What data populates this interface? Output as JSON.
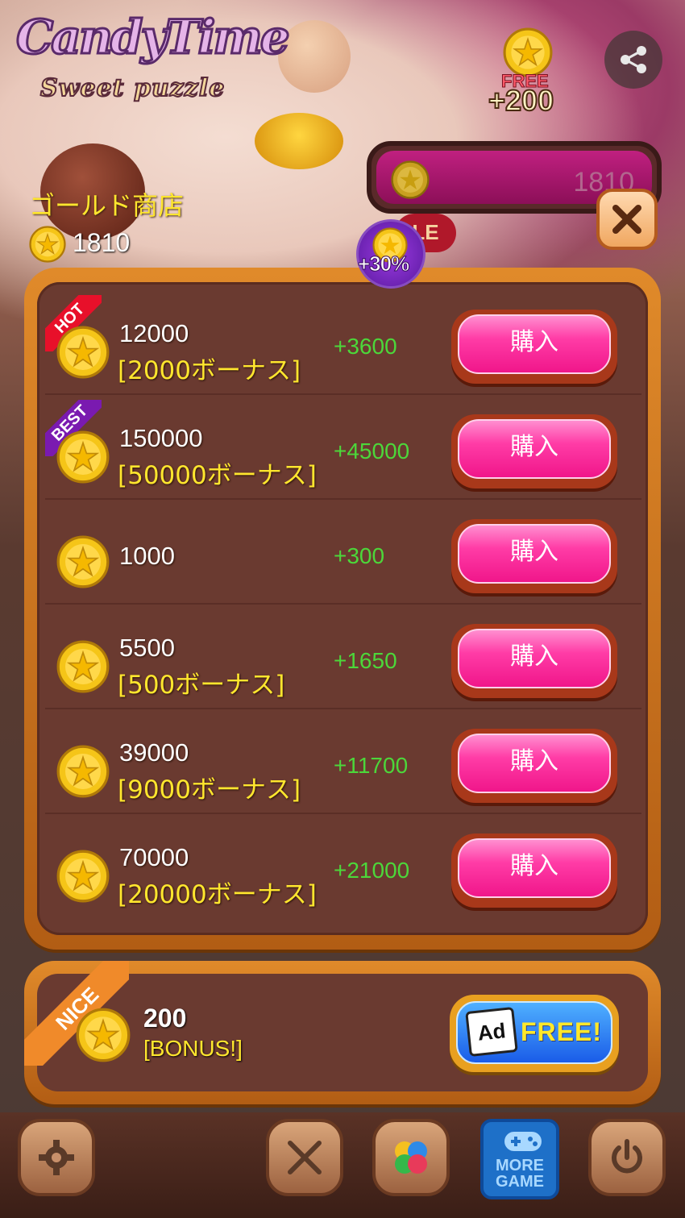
{
  "logo": {
    "line1": "CandyTime",
    "line2": "Sweet puzzle"
  },
  "free_bonus": {
    "label": "FREE",
    "amount": "+200"
  },
  "gold_bar": {
    "value": "1810"
  },
  "sale_badge": {
    "text": "LE"
  },
  "shop": {
    "title": "ゴールド商店",
    "balance": "1810",
    "bonus_badge": "+30%"
  },
  "items": [
    {
      "ribbon": "HOT",
      "amount": "12000",
      "bonus": "[2000ボーナス]",
      "plus": "+3600",
      "buy": "購入"
    },
    {
      "ribbon": "BEST",
      "amount": "150000",
      "bonus": "[50000ボーナス]",
      "plus": "+45000",
      "buy": "購入"
    },
    {
      "ribbon": "",
      "amount": "1000",
      "bonus": "",
      "plus": "+300",
      "buy": "購入"
    },
    {
      "ribbon": "",
      "amount": "5500",
      "bonus": "[500ボーナス]",
      "plus": "+1650",
      "buy": "購入"
    },
    {
      "ribbon": "",
      "amount": "39000",
      "bonus": "[9000ボーナス]",
      "plus": "+11700",
      "buy": "購入"
    },
    {
      "ribbon": "",
      "amount": "70000",
      "bonus": "[20000ボーナス]",
      "plus": "+21000",
      "buy": "購入"
    }
  ],
  "ad_offer": {
    "ribbon": "NICE",
    "amount": "200",
    "label": "[BONUS!]",
    "ad_icon": "Ad",
    "button": "FREE!"
  },
  "nav": {
    "settings": "gear-icon",
    "battle": "swords-icon",
    "circles": "color-circles-icon",
    "more_label": "MORE GAME",
    "power": "power-icon"
  },
  "colors": {
    "accent_pink": "#f0168a",
    "gold_text": "#ffe62e",
    "bonus_green": "#4cd73a",
    "panel_orange": "#e08a2a"
  }
}
